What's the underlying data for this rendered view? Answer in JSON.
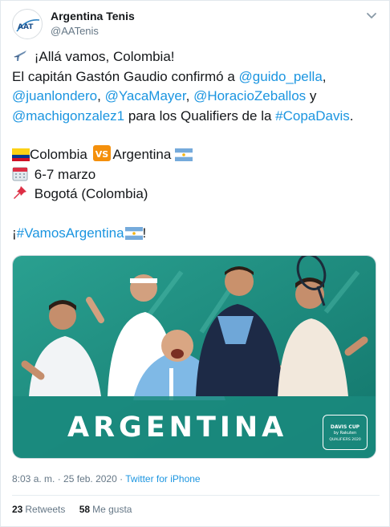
{
  "author": {
    "display_name": "Argentina Tenis",
    "handle": "@AATenis",
    "avatar_text": "AAT"
  },
  "tweet": {
    "line1": "¡Allá vamos, Colombia!",
    "line2_prefix": "El capitán Gastón Gaudio confirmó a ",
    "mention_pella": "@guido_pella",
    "mention_londero": "@juanlondero",
    "sep1": ", ",
    "mention_mayer": "@YacaMayer",
    "sep2": ", ",
    "mention_zeballos": "@HoracioZeballos",
    "line3_suffix": " y",
    "mention_gonzalez": "@machigonzalez1",
    "line4_middle": " para los Qualifiers de la ",
    "hashtag_copa": "#CopaDavis",
    "line4_end": ".",
    "match_home": "Colombia",
    "match_vs": "VS",
    "match_away": "Argentina",
    "dates": "6-7 marzo",
    "venue": "Bogotá (Colombia)",
    "closing_prefix": "¡",
    "hashtag_vamos": "#VamosArgentina",
    "closing_suffix": "!"
  },
  "media": {
    "title": "ARGENTINA",
    "badge_line1": "DAVIS CUP",
    "badge_line2": "by Rakuten",
    "badge_line3": "QUALIFIERS 2020"
  },
  "meta": {
    "time": "8:03 a. m.",
    "separator": " · ",
    "date": "25 feb. 2020",
    "source": "Twitter for iPhone"
  },
  "stats": {
    "retweets_count": "23",
    "retweets_label": "Retweets",
    "likes_count": "58",
    "likes_label": "Me gusta"
  },
  "colors": {
    "link": "#1b95e0",
    "muted": "#657786",
    "text": "#14171a",
    "media_teal": "#1a8a7e"
  },
  "icons": [
    "airplane-icon",
    "colombia-flag-icon",
    "vs-icon",
    "argentina-flag-icon",
    "calendar-icon",
    "pushpin-icon",
    "chevron-down-icon"
  ]
}
